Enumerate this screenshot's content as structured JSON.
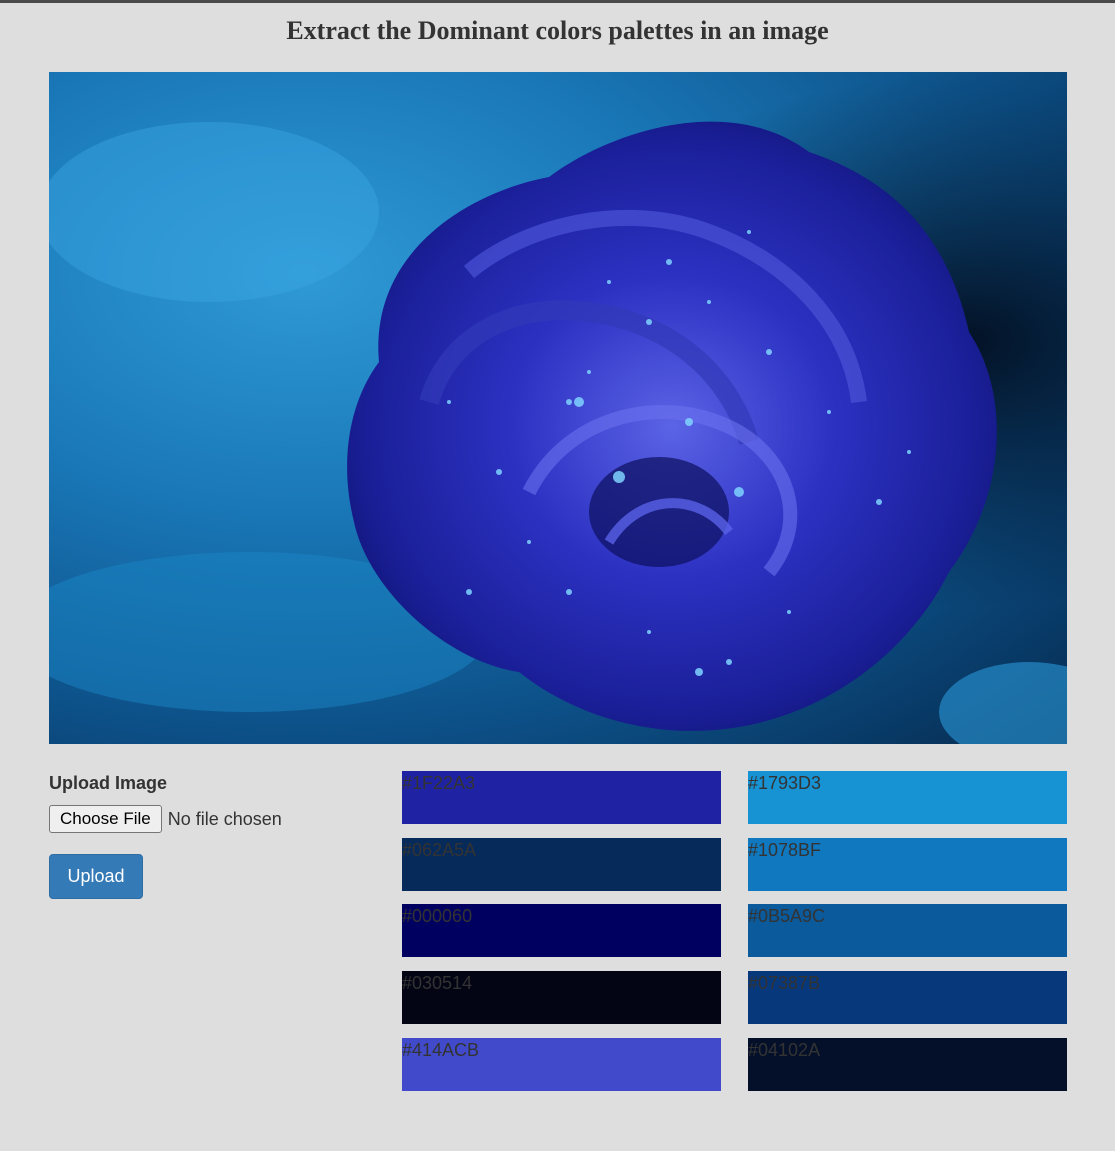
{
  "page": {
    "title": "Extract the Dominant colors palettes in an image"
  },
  "image": {
    "alt": "blue rose with water droplets"
  },
  "form": {
    "label": "Upload Image",
    "file_button": "Choose File",
    "file_status": "No file chosen",
    "upload_button": "Upload"
  },
  "palette": {
    "left": [
      {
        "hex": "#1F22A3",
        "color": "#1F22A3"
      },
      {
        "hex": "#062A5A",
        "color": "#062A5A"
      },
      {
        "hex": "#000060",
        "color": "#000060"
      },
      {
        "hex": "#030514",
        "color": "#030514"
      },
      {
        "hex": "#414ACB",
        "color": "#414ACB"
      }
    ],
    "right": [
      {
        "hex": "#1793D3",
        "color": "#1793D3"
      },
      {
        "hex": "#1078BF",
        "color": "#1078BF"
      },
      {
        "hex": "#0B5A9C",
        "color": "#0B5A9C"
      },
      {
        "hex": "#07387B",
        "color": "#07387B"
      },
      {
        "hex": "#04102A",
        "color": "#04102A"
      }
    ]
  }
}
